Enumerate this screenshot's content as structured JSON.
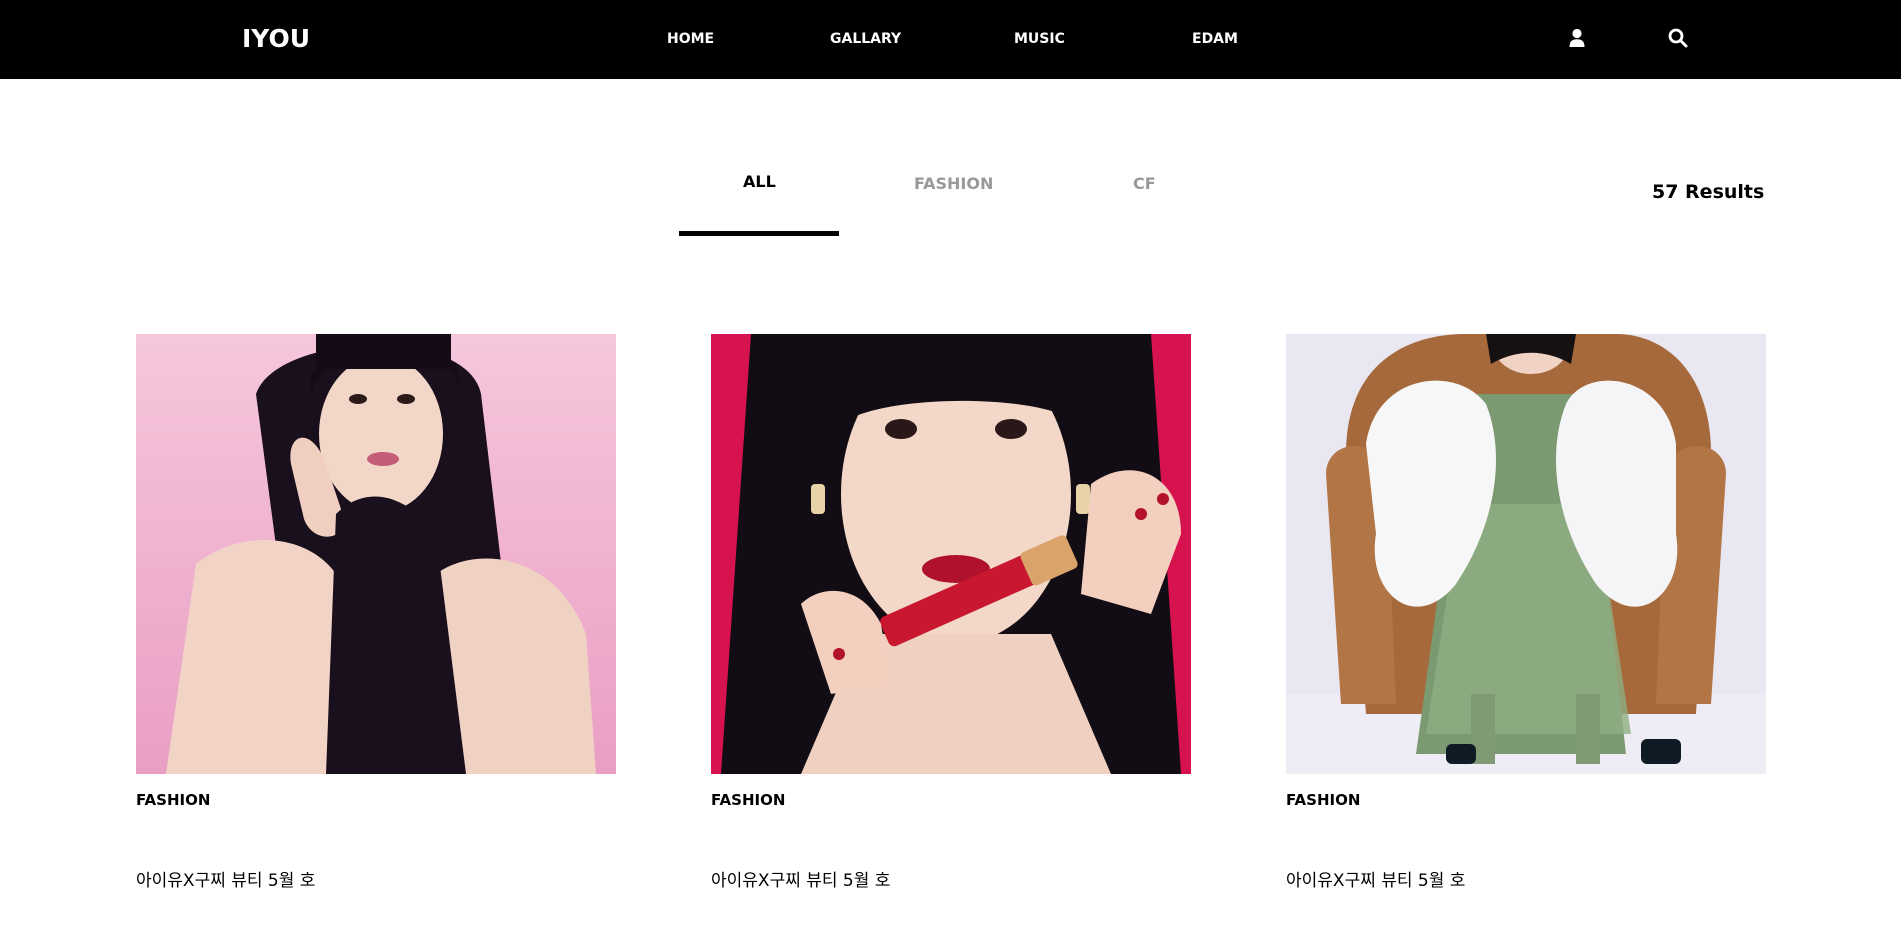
{
  "header": {
    "logo": "IYOU",
    "nav": [
      "HOME",
      "GALLARY",
      "MUSIC",
      "EDAM"
    ],
    "icons": [
      "user-icon",
      "search-icon"
    ]
  },
  "filters": {
    "tabs": [
      "ALL",
      "FASHION",
      "CF"
    ],
    "active": "ALL",
    "results": "57 Results"
  },
  "cards": [
    {
      "category": "FASHION",
      "title": "아이유X구찌 뷰티 5월 호"
    },
    {
      "category": "FASHION",
      "title": "아이유X구찌 뷰티 5월 호"
    },
    {
      "category": "FASHION",
      "title": "아이유X구찌 뷰티 5월 호"
    }
  ],
  "colors": {
    "header_bg": "#000000",
    "card1_bg": "#f3bcd6",
    "card2_bg": "#d6124f",
    "card3_bg": "#e7e6f1"
  }
}
